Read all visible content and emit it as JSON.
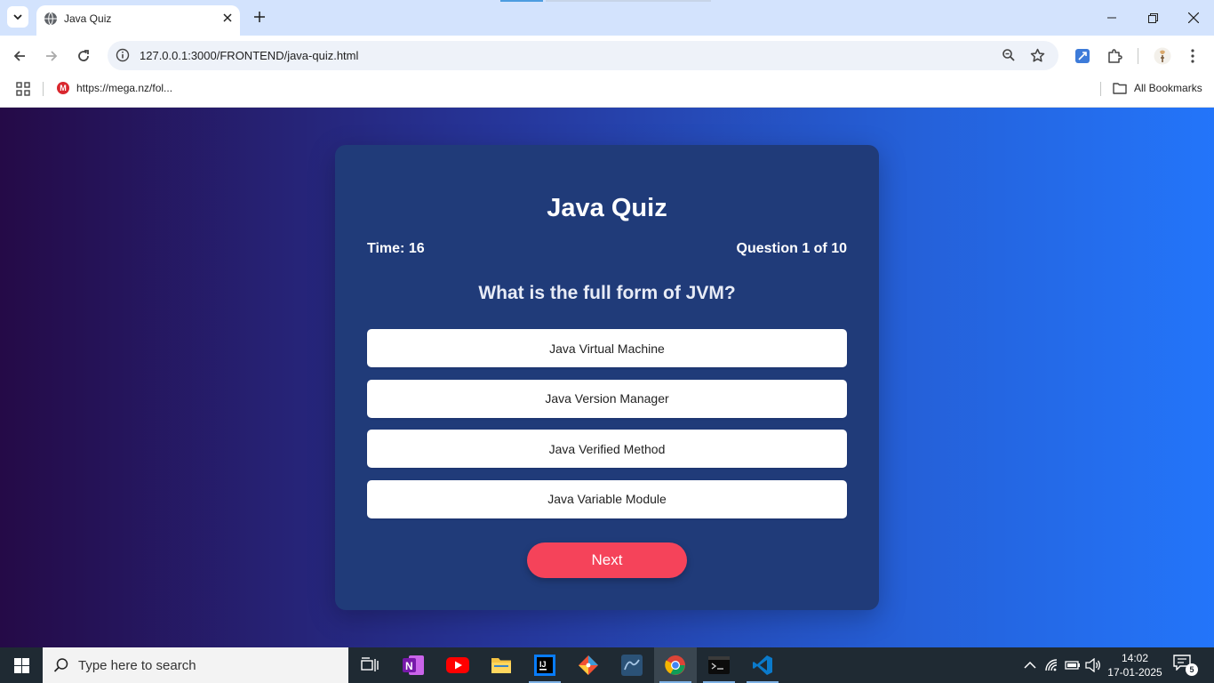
{
  "browser": {
    "tab_title": "Java Quiz",
    "url": "127.0.0.1:3000/FRONTEND/java-quiz.html",
    "bookmarks": [
      {
        "label": "https://mega.nz/fol...",
        "icon": "mega-icon"
      }
    ],
    "all_bookmarks_label": "All Bookmarks"
  },
  "quiz": {
    "title": "Java Quiz",
    "timer": "Time: 16",
    "counter": "Question 1 of 10",
    "question": "What is the full form of JVM?",
    "options": [
      "Java Virtual Machine",
      "Java Version Manager",
      "Java Verified Method",
      "Java Variable Module"
    ],
    "next_label": "Next"
  },
  "taskbar": {
    "search_placeholder": "Type here to search",
    "apps": [
      "task-view",
      "onenote",
      "youtube",
      "file-explorer",
      "intellij",
      "git",
      "mysql-workbench",
      "chrome",
      "terminal",
      "vscode"
    ],
    "time": "14:02",
    "date": "17-01-2025",
    "notification_count": "5"
  },
  "colors": {
    "tabstrip": "#d3e3fd",
    "card": "#203b79",
    "next_button": "#f5435a",
    "taskbar": "#1f2a33"
  }
}
